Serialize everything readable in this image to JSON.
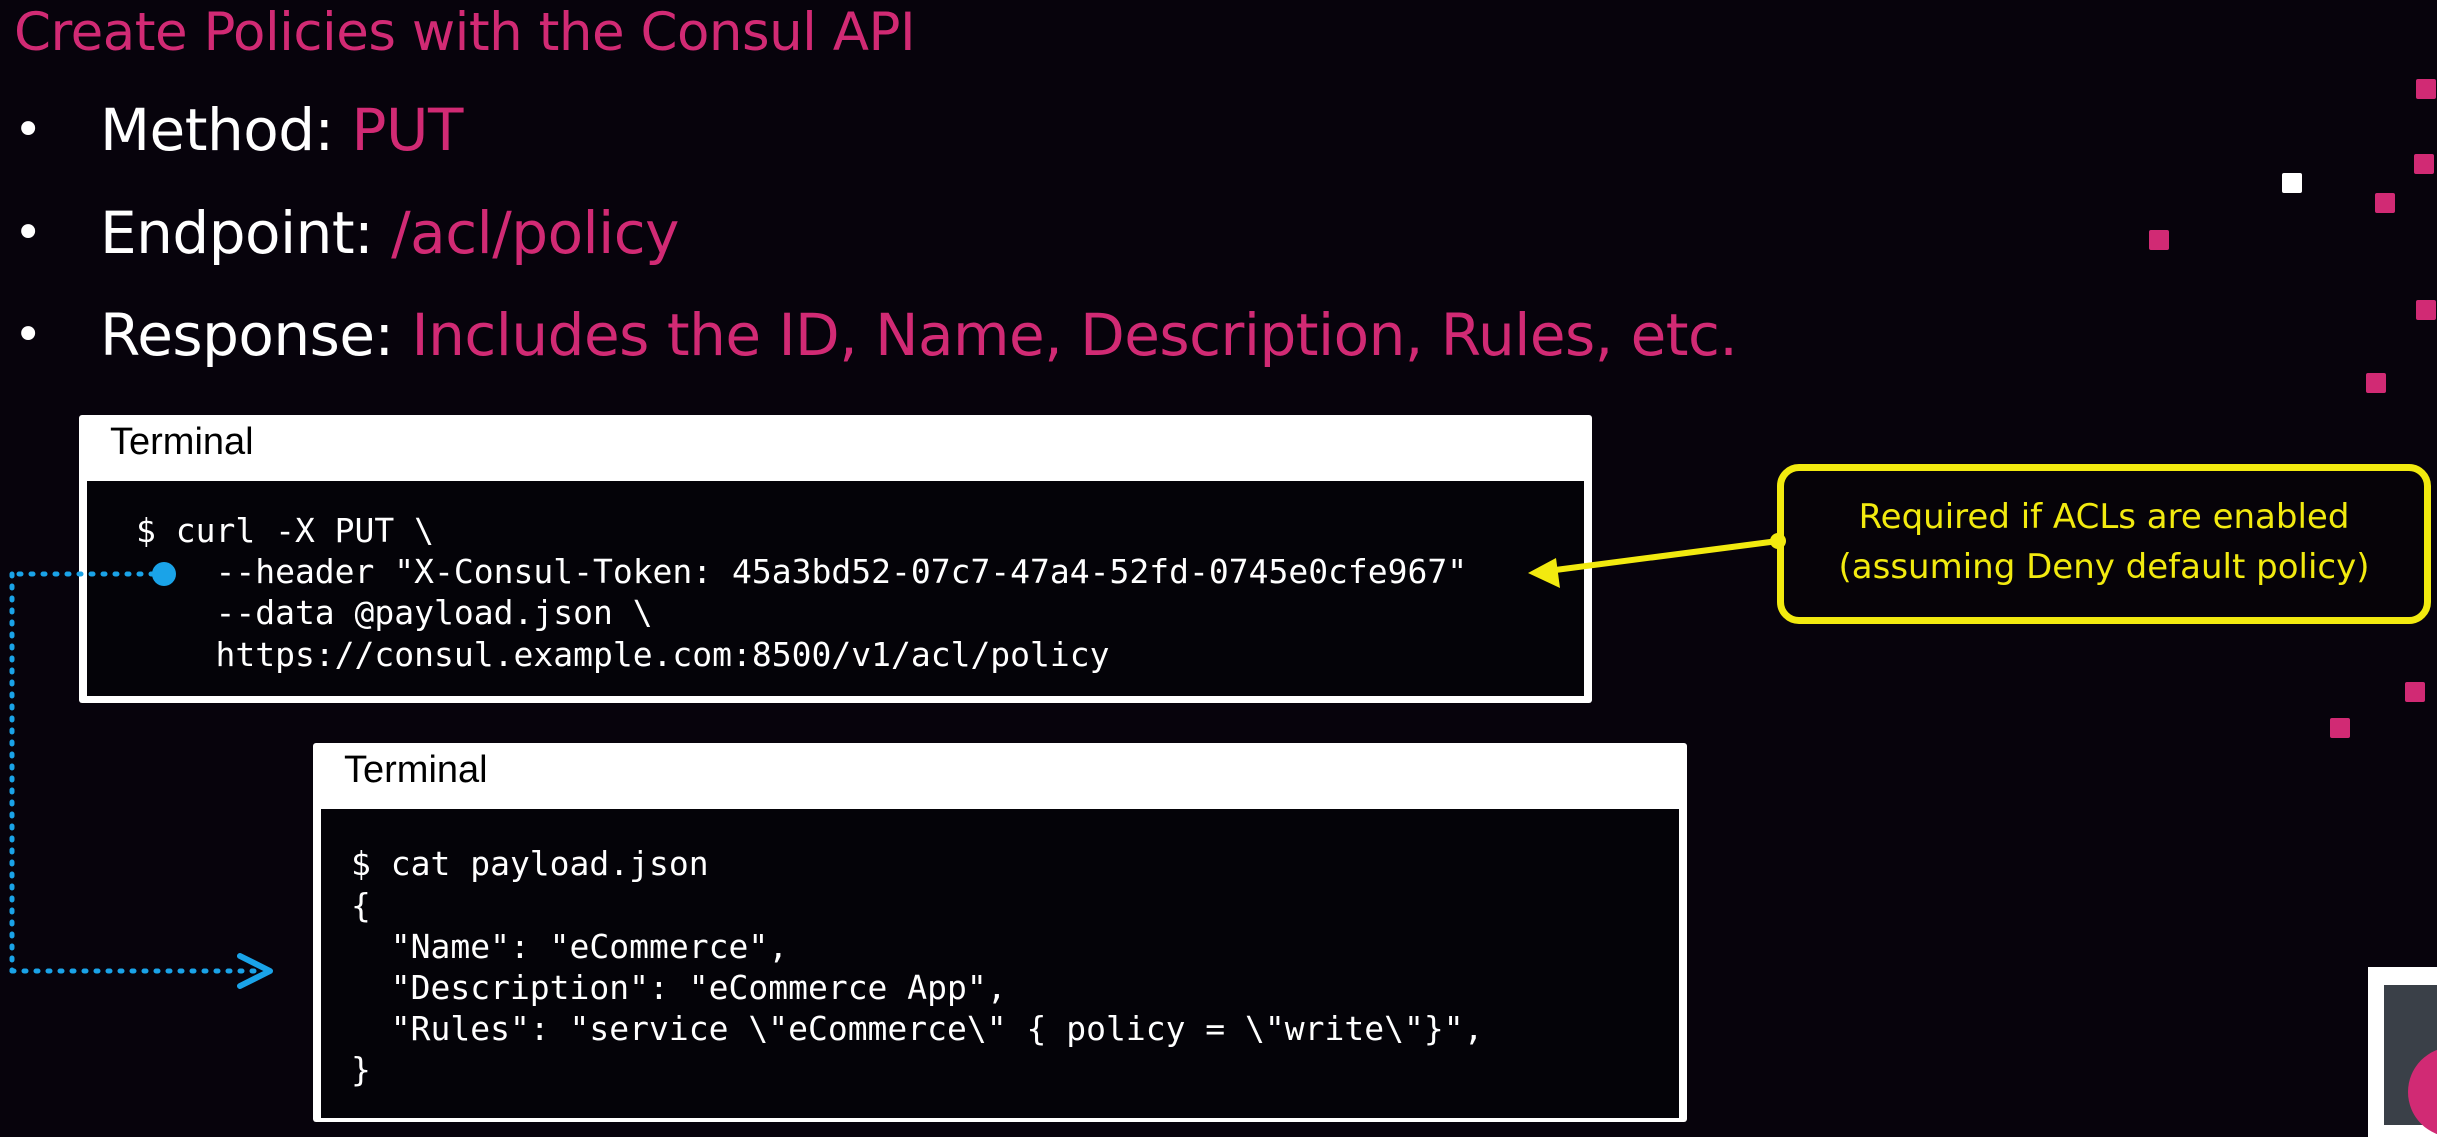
{
  "slide": {
    "title": "Create Policies with the Consul API"
  },
  "bullets": [
    {
      "label": "Method: ",
      "value": "PUT"
    },
    {
      "label": "Endpoint: ",
      "value": "/acl/policy"
    },
    {
      "label": "Response: ",
      "value": "Includes the ID, Name, Description, Rules, etc."
    }
  ],
  "terminal1": {
    "title": "Terminal",
    "lines": [
      "$ curl -X PUT \\",
      "    --header \"X-Consul-Token: 45a3bd52-07c7-47a4-52fd-0745e0cfe967\"",
      "    --data @payload.json \\",
      "    https://consul.example.com:8500/v1/acl/policy"
    ]
  },
  "terminal2": {
    "title": "Terminal",
    "lines": [
      "$ cat payload.json",
      "{",
      "  \"Name\": \"eCommerce\",",
      "  \"Description\": \"eCommerce App\",",
      "  \"Rules\": \"service \\\"eCommerce\\\" { policy = \\\"write\\\"}\",",
      "}"
    ]
  },
  "callout": {
    "line1": "Required if ACLs are enabled",
    "line2": "(assuming Deny default policy)"
  },
  "colors": {
    "accent": "#d12a74",
    "callout": "#f2ea0f",
    "connector": "#1aa3e8",
    "background": "#07030c"
  },
  "icons": {
    "bullet": "bullet-dot-icon",
    "connector_start": "connector-dot-icon",
    "connector_end": "connector-arrowhead-icon",
    "callout_arrow": "callout-arrow-icon"
  }
}
